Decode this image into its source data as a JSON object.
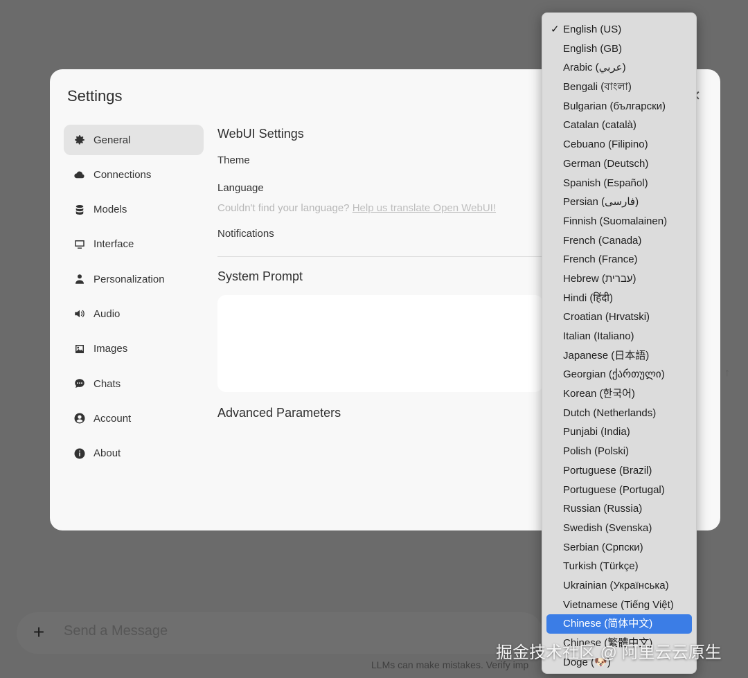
{
  "modal": {
    "title": "Settings",
    "close_glyph": "✕"
  },
  "sidebar": {
    "items": [
      {
        "label": "General",
        "icon": "gear-icon",
        "active": true
      },
      {
        "label": "Connections",
        "icon": "cloud-icon"
      },
      {
        "label": "Models",
        "icon": "database-icon"
      },
      {
        "label": "Interface",
        "icon": "monitor-icon"
      },
      {
        "label": "Personalization",
        "icon": "user-icon"
      },
      {
        "label": "Audio",
        "icon": "speaker-icon"
      },
      {
        "label": "Images",
        "icon": "image-icon"
      },
      {
        "label": "Chats",
        "icon": "chat-bubble-icon"
      },
      {
        "label": "Account",
        "icon": "account-circle-icon"
      },
      {
        "label": "About",
        "icon": "info-icon"
      }
    ]
  },
  "general": {
    "webui_settings_title": "WebUI Settings",
    "theme_label": "Theme",
    "language_label": "Language",
    "language_hint": "Couldn't find your language?",
    "language_hint_link": "Help us translate Open WebUI!",
    "notifications_label": "Notifications",
    "system_prompt_title": "System Prompt",
    "advanced_parameters_title": "Advanced Parameters"
  },
  "language_dropdown": {
    "selected": "English (US)",
    "highlighted": "Chinese (简体中文)",
    "options": [
      "English (US)",
      "English (GB)",
      "Arabic (عربي)",
      "Bengali (বাংলা)",
      "Bulgarian (български)",
      "Catalan (català)",
      "Cebuano (Filipino)",
      "German (Deutsch)",
      "Spanish (Español)",
      "Persian (فارسی)",
      "Finnish (Suomalainen)",
      "French (Canada)",
      "French (France)",
      "Hebrew (עברית)",
      "Hindi (हिंदी)",
      "Croatian (Hrvatski)",
      "Italian (Italiano)",
      "Japanese (日本語)",
      "Georgian (ქართული)",
      "Korean (한국어)",
      "Dutch (Netherlands)",
      "Punjabi (India)",
      "Polish (Polski)",
      "Portuguese (Brazil)",
      "Portuguese (Portugal)",
      "Russian (Russia)",
      "Swedish (Svenska)",
      "Serbian (Српски)",
      "Turkish (Türkçe)",
      "Ukrainian (Українська)",
      "Vietnamese (Tiếng Việt)",
      "Chinese (简体中文)",
      "Chinese (繁體中文)",
      "Doge (🐶)"
    ]
  },
  "chat": {
    "plus_glyph": "+",
    "placeholder": "Send a Message",
    "disclaimer": "LLMs can make mistakes. Verify imp",
    "send_glyph": "↑"
  },
  "watermark": "掘金技术社区 @ 阿里云云原生"
}
